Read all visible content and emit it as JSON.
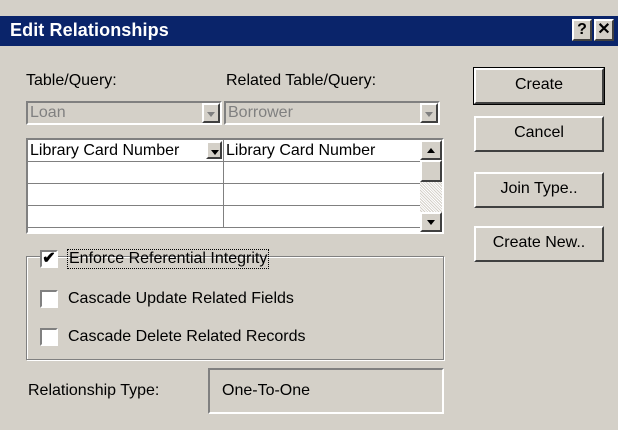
{
  "window": {
    "title": "Edit Relationships",
    "help_glyph": "?",
    "close_glyph": "✕"
  },
  "labels": {
    "table_query": "Table/Query:",
    "related_table_query": "Related Table/Query:"
  },
  "combos": {
    "table": "Loan",
    "related": "Borrower"
  },
  "grid": {
    "rows": [
      {
        "left": "Library Card Number",
        "right": "Library Card Number"
      },
      {
        "left": "",
        "right": ""
      },
      {
        "left": "",
        "right": ""
      },
      {
        "left": "",
        "right": ""
      }
    ]
  },
  "options": {
    "enforce": {
      "label": "Enforce Referential Integrity",
      "checked": true
    },
    "cascade_update": {
      "label": "Cascade Update Related Fields",
      "checked": false
    },
    "cascade_delete": {
      "label": "Cascade Delete Related Records",
      "checked": false
    }
  },
  "relationship": {
    "label": "Relationship Type:",
    "value": "One-To-One"
  },
  "buttons": {
    "create": "Create",
    "cancel": "Cancel",
    "join_type": "Join Type..",
    "create_new": "Create New.."
  }
}
